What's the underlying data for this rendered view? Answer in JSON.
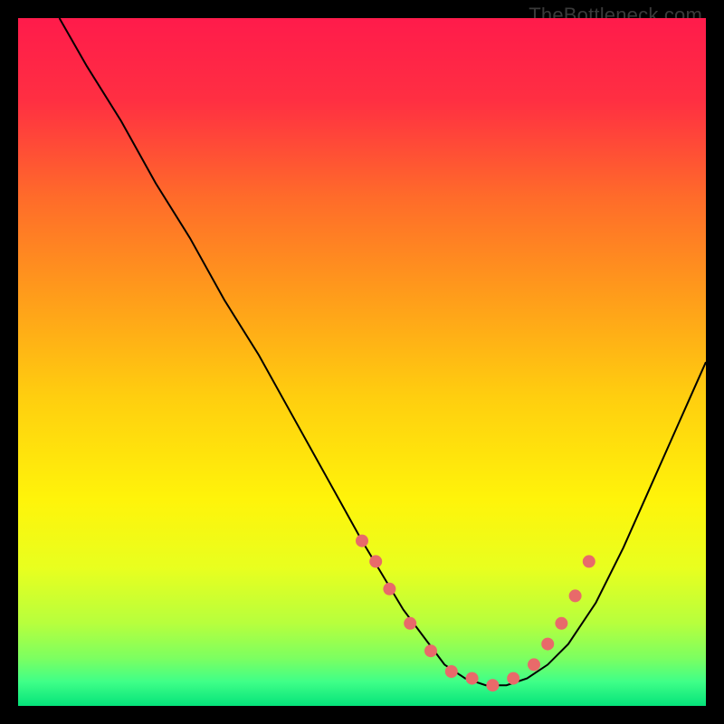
{
  "watermark": "TheBottleneck.com",
  "chart_data": {
    "type": "line",
    "title": "",
    "xlabel": "",
    "ylabel": "",
    "xlim": [
      0,
      100
    ],
    "ylim": [
      0,
      100
    ],
    "grid": false,
    "legend": false,
    "series": [
      {
        "name": "bottleneck-curve",
        "color": "#000000",
        "x": [
          6,
          10,
          15,
          20,
          25,
          30,
          35,
          40,
          45,
          50,
          53,
          56,
          59,
          62,
          65,
          68,
          71,
          74,
          77,
          80,
          84,
          88,
          92,
          96,
          100
        ],
        "y": [
          100,
          93,
          85,
          76,
          68,
          59,
          51,
          42,
          33,
          24,
          19,
          14,
          10,
          6,
          4,
          3,
          3,
          4,
          6,
          9,
          15,
          23,
          32,
          41,
          50
        ]
      }
    ],
    "markers": {
      "name": "highlight-dots",
      "color": "#e86a6a",
      "radius": 7,
      "x": [
        50,
        52,
        54,
        57,
        60,
        63,
        66,
        69,
        72,
        75,
        77,
        79,
        81,
        83
      ],
      "y": [
        24,
        21,
        17,
        12,
        8,
        5,
        4,
        3,
        4,
        6,
        9,
        12,
        16,
        21
      ]
    },
    "background_gradient": {
      "type": "vertical",
      "stops": [
        {
          "offset": 0.0,
          "color": "#ff1b4b"
        },
        {
          "offset": 0.12,
          "color": "#ff2f42"
        },
        {
          "offset": 0.26,
          "color": "#ff6b2a"
        },
        {
          "offset": 0.4,
          "color": "#ff9b1b"
        },
        {
          "offset": 0.55,
          "color": "#ffce0f"
        },
        {
          "offset": 0.7,
          "color": "#fff40a"
        },
        {
          "offset": 0.8,
          "color": "#e8ff1f"
        },
        {
          "offset": 0.88,
          "color": "#b7ff3d"
        },
        {
          "offset": 0.93,
          "color": "#7dff60"
        },
        {
          "offset": 0.965,
          "color": "#3fff88"
        },
        {
          "offset": 1.0,
          "color": "#05e37a"
        }
      ]
    }
  }
}
